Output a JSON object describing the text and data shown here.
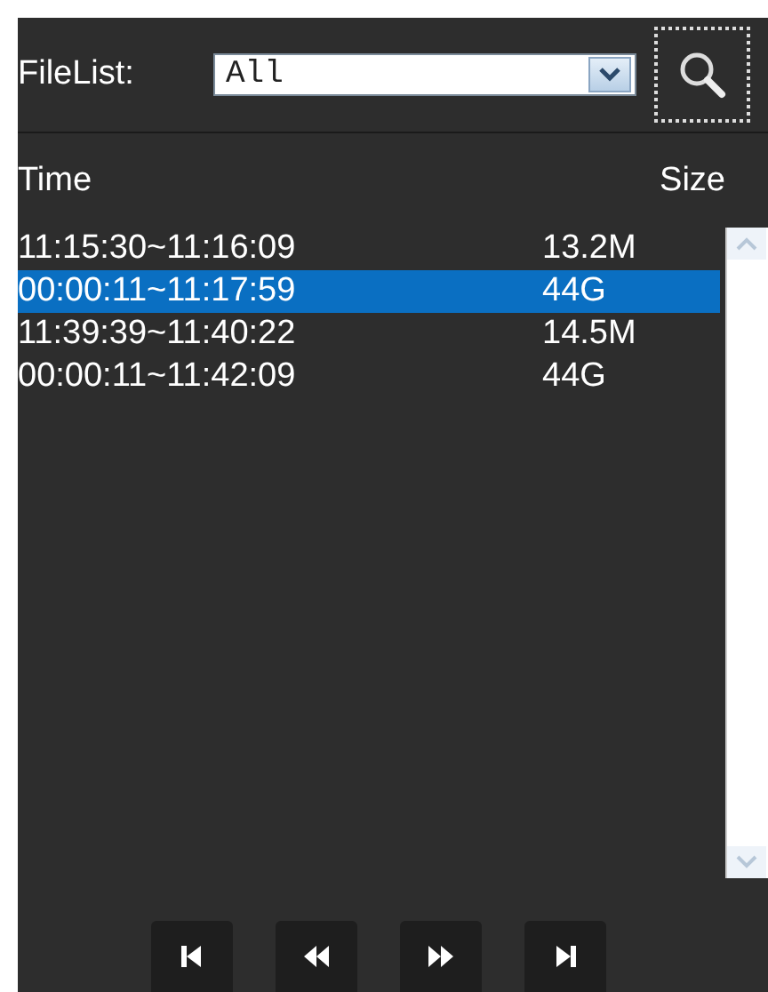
{
  "filter": {
    "label": "FileList:",
    "value": "All"
  },
  "columns": [
    {
      "label": "Time"
    },
    {
      "label": "Size"
    }
  ],
  "rows": [
    {
      "time": "11:15:30~11:16:09",
      "size": "13.2M",
      "selected": false
    },
    {
      "time": "00:00:11~11:17:59",
      "size": "44G",
      "selected": true
    },
    {
      "time": "11:39:39~11:40:22",
      "size": "14.5M",
      "selected": false
    },
    {
      "time": "00:00:11~11:42:09",
      "size": "44G",
      "selected": false
    }
  ],
  "playback_buttons": [
    {
      "kind": "first"
    },
    {
      "kind": "rewind"
    },
    {
      "kind": "forward"
    },
    {
      "kind": "last"
    }
  ]
}
